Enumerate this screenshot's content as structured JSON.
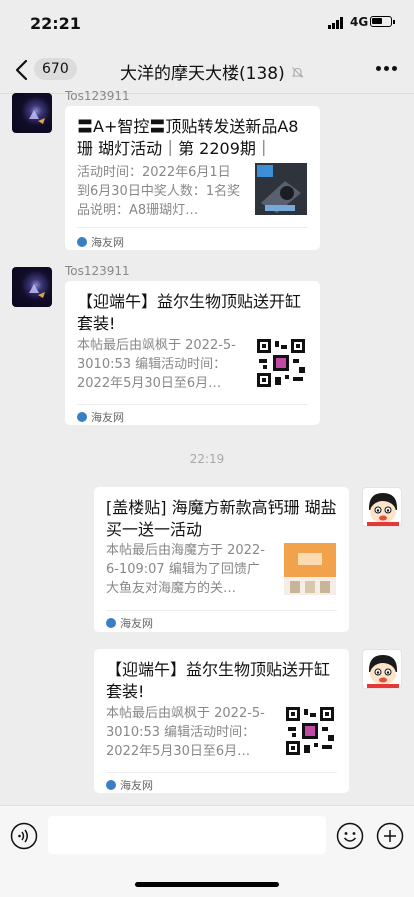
{
  "status_bar": {
    "time": "22:21",
    "network": "4G"
  },
  "nav": {
    "back_count": "670",
    "title": "大洋的摩天大楼(138)"
  },
  "messages": [
    {
      "sender": "Tos123911",
      "title": "〓A+智控〓顶贴转发送新品A8珊 瑚灯活动｜第 2209期｜",
      "desc": "活动时间：2022年6月1日到6月30日中奖人数：1名奖品说明：A8珊瑚灯…",
      "source": "海友网"
    },
    {
      "sender": "Tos123911",
      "title": "【迎端午】益尔生物顶贴送开缸套装!",
      "desc": "本帖最后由飒枫于 2022-5-3010:53 编辑活动时间：2022年5月30日至6月…",
      "source": "海友网"
    },
    {
      "title": "[盖楼贴] 海魔方新款高钙珊 瑚盐买一送一活动",
      "desc": "本帖最后由海魔方于 2022-6-109:07 编辑为了回馈广大鱼友对海魔方的关…",
      "source": "海友网"
    },
    {
      "title": "【迎端午】益尔生物顶贴送开缸套装!",
      "desc": "本帖最后由飒枫于 2022-5-3010:53 编辑活动时间：2022年5月30日至6月…",
      "source": "海友网"
    }
  ],
  "timestamp": "22:19",
  "colors": {
    "background": "#ededed",
    "card": "#ffffff",
    "muted_text": "#888888"
  },
  "icons": [
    "back-chevron-icon",
    "mute-bell-icon",
    "more-dots-icon",
    "voice-icon",
    "emoji-icon",
    "plus-icon"
  ]
}
